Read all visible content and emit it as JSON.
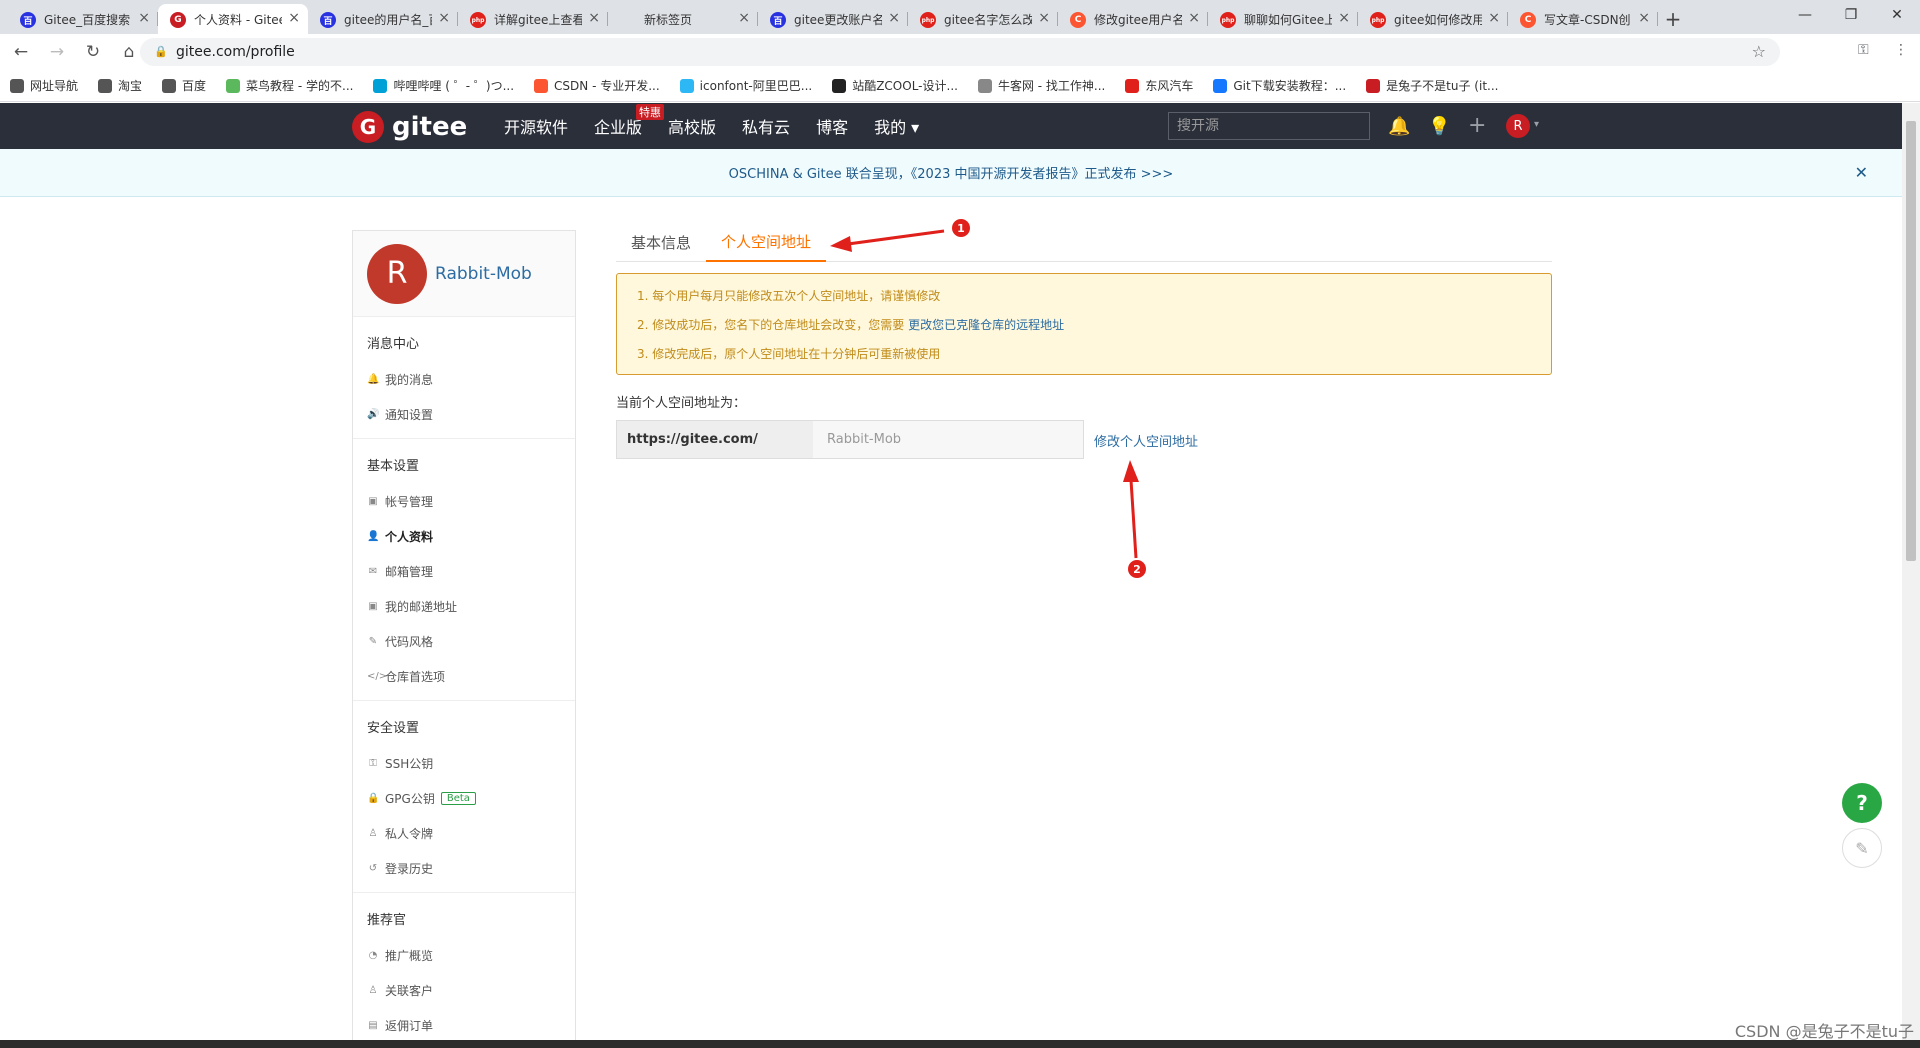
{
  "browser": {
    "tabs": [
      {
        "label": "Gitee_百度搜索",
        "icon_color": "#2932e1",
        "icon_glyph": "百",
        "active": false
      },
      {
        "label": "个人资料 - Gitee",
        "icon_color": "#c71d23",
        "icon_glyph": "G",
        "active": true
      },
      {
        "label": "gitee的用户名_百",
        "icon_color": "#2932e1",
        "icon_glyph": "百",
        "active": false
      },
      {
        "label": "详解gitee上查看",
        "icon_color": "#e0201a",
        "icon_glyph": "php",
        "active": false
      },
      {
        "label": "新标签页",
        "icon_color": "",
        "icon_glyph": "",
        "active": false
      },
      {
        "label": "gitee更改账户名",
        "icon_color": "#2932e1",
        "icon_glyph": "百",
        "active": false
      },
      {
        "label": "gitee名字怎么改",
        "icon_color": "#e0201a",
        "icon_glyph": "php",
        "active": false
      },
      {
        "label": "修改gitee用户名",
        "icon_color": "#fc5531",
        "icon_glyph": "C",
        "active": false
      },
      {
        "label": "聊聊如何Gitee上",
        "icon_color": "#e0201a",
        "icon_glyph": "php",
        "active": false
      },
      {
        "label": "gitee如何修改用",
        "icon_color": "#e0201a",
        "icon_glyph": "php",
        "active": false
      },
      {
        "label": "写文章-CSDN创",
        "icon_color": "#fc5531",
        "icon_glyph": "C",
        "active": false
      }
    ],
    "new_tab": "+",
    "url": "gitee.com/profile",
    "bookmarks": [
      {
        "label": "网址导航",
        "color": "#555"
      },
      {
        "label": "淘宝",
        "color": "#555"
      },
      {
        "label": "百度",
        "color": "#555"
      },
      {
        "label": "菜鸟教程 - 学的不...",
        "color": "#5cb85c"
      },
      {
        "label": "哔哩哔哩 ( ゜- ゜)つ...",
        "color": "#00a1d6"
      },
      {
        "label": "CSDN - 专业开发...",
        "color": "#fc5531"
      },
      {
        "label": "iconfont-阿里巴巴...",
        "color": "#2db7f5"
      },
      {
        "label": "站酷ZCOOL-设计...",
        "color": "#222"
      },
      {
        "label": "牛客网 - 找工作神...",
        "color": "#888"
      },
      {
        "label": "东风汽车",
        "color": "#e0201a"
      },
      {
        "label": "Git下载安装教程：...",
        "color": "#1677ff"
      },
      {
        "label": "是兔子不是tu子 (it...",
        "color": "#c71d23"
      }
    ]
  },
  "header": {
    "logo_text": "gitee",
    "nav": [
      {
        "label": "开源软件"
      },
      {
        "label": "企业版",
        "badge": "特惠"
      },
      {
        "label": "高校版"
      },
      {
        "label": "私有云"
      },
      {
        "label": "博客"
      },
      {
        "label": "我的 ▾"
      }
    ],
    "search_placeholder": "搜开源",
    "avatar_letter": "R"
  },
  "banner": {
    "text": "OSCHINA & Gitee 联合呈现，《2023 中国开源开发者报告》正式发布 >>>",
    "close": "✕"
  },
  "sidebar": {
    "avatar_letter": "R",
    "username": "Rabbit-Mob",
    "groups": [
      {
        "title": "消息中心",
        "items": [
          {
            "label": "我的消息",
            "icon": "bell-icon",
            "glyph": "🔔"
          },
          {
            "label": "通知设置",
            "icon": "speaker-icon",
            "glyph": "🔊"
          }
        ]
      },
      {
        "title": "基本设置",
        "items": [
          {
            "label": "帐号管理",
            "icon": "id-card-icon",
            "glyph": "▣"
          },
          {
            "label": "个人资料",
            "icon": "user-icon",
            "glyph": "👤",
            "active": true
          },
          {
            "label": "邮箱管理",
            "icon": "envelope-icon",
            "glyph": "✉"
          },
          {
            "label": "我的邮递地址",
            "icon": "address-card-icon",
            "glyph": "▣"
          },
          {
            "label": "代码风格",
            "icon": "brush-icon",
            "glyph": "✎"
          },
          {
            "label": "仓库首选项",
            "icon": "code-icon",
            "glyph": "</>"
          }
        ]
      },
      {
        "title": "安全设置",
        "items": [
          {
            "label": "SSH公钥",
            "icon": "key-icon",
            "glyph": "⚿"
          },
          {
            "label": "GPG公钥",
            "icon": "lock-icon",
            "glyph": "🔒",
            "badge": "Beta"
          },
          {
            "label": "私人令牌",
            "icon": "users-icon",
            "glyph": "♙"
          },
          {
            "label": "登录历史",
            "icon": "history-icon",
            "glyph": "↺"
          }
        ]
      },
      {
        "title": "推荐官",
        "items": [
          {
            "label": "推广概览",
            "icon": "chart-icon",
            "glyph": "◔"
          },
          {
            "label": "关联客户",
            "icon": "user-plus-icon",
            "glyph": "♙"
          },
          {
            "label": "返佣订单",
            "icon": "order-icon",
            "glyph": "▤"
          }
        ]
      }
    ]
  },
  "main": {
    "tabs": [
      {
        "label": "基本信息",
        "active": false
      },
      {
        "label": "个人空间地址",
        "active": true
      }
    ],
    "notice": {
      "line1": "1. 每个用户每月只能修改五次个人空间地址，请谨慎修改",
      "line2_prefix": "2. 修改成功后，您名下的仓库地址会改变，您需要",
      "line2_link": "更改您已克隆仓库的远程地址",
      "line3": "3. 修改完成后，原个人空间地址在十分钟后可重新被使用"
    },
    "current_label": "当前个人空间地址为：",
    "url_prefix": "https://gitee.com/",
    "url_value": "Rabbit-Mob",
    "edit_link": "修改个人空间地址"
  },
  "annotations": {
    "marker1": "1",
    "marker2": "2"
  },
  "floating": {
    "help": "?",
    "edit": "✎"
  },
  "watermark": "CSDN @是兔子不是tu子"
}
